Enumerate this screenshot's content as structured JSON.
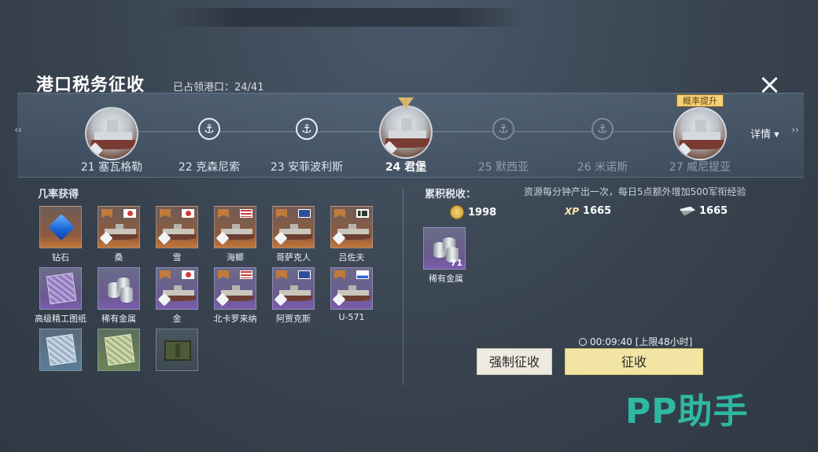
{
  "header": {
    "title": "港口税务征收",
    "occupied_ports": "已占领港口：24/41"
  },
  "ports": [
    {
      "label": "21 塞瓦格勒",
      "type": "ship",
      "state": "normal"
    },
    {
      "label": "22 克森尼索",
      "type": "anchor",
      "state": "normal"
    },
    {
      "label": "23 安菲波利斯",
      "type": "anchor",
      "state": "normal"
    },
    {
      "label": "24 君堡",
      "type": "ship",
      "state": "current"
    },
    {
      "label": "25 默西亚",
      "type": "anchor",
      "state": "dim"
    },
    {
      "label": "26 米诺斯",
      "type": "anchor",
      "state": "dim"
    },
    {
      "label": "27 威尼提亚",
      "type": "ship",
      "state": "dim",
      "badge": "概率提升"
    }
  ],
  "details_label": "详情",
  "left_panel": {
    "title": "几率获得",
    "items": [
      {
        "name": "钻石",
        "rarity": "orange",
        "icon": "diamond-icon"
      },
      {
        "name": "桑",
        "rarity": "orange",
        "icon": "ship-icon",
        "flag": "jp"
      },
      {
        "name": "雪",
        "rarity": "orange",
        "icon": "ship-icon",
        "flag": "jp"
      },
      {
        "name": "海鲫",
        "rarity": "orange",
        "icon": "submarine-icon",
        "flag": "us"
      },
      {
        "name": "哥萨克人",
        "rarity": "orange",
        "icon": "ship-icon",
        "flag": "uk"
      },
      {
        "name": "吕佐夫",
        "rarity": "orange",
        "icon": "ship-icon",
        "flag": "de"
      },
      {
        "name": "高级精工图纸",
        "rarity": "purple",
        "icon": "blueprint-icon"
      },
      {
        "name": "稀有金属",
        "rarity": "purple",
        "icon": "metal-icon"
      },
      {
        "name": "金",
        "rarity": "purple",
        "icon": "ship-icon",
        "flag": "jp"
      },
      {
        "name": "北卡罗来纳",
        "rarity": "purple",
        "icon": "ship-icon",
        "flag": "us"
      },
      {
        "name": "阿贾克斯",
        "rarity": "purple",
        "icon": "ship-icon",
        "flag": "uk"
      },
      {
        "name": "U-571",
        "rarity": "purple",
        "icon": "submarine-icon",
        "flag": "de"
      },
      {
        "name": "",
        "rarity": "blue",
        "icon": "blueprint-icon"
      },
      {
        "name": "",
        "rarity": "green",
        "icon": "blueprint-icon"
      },
      {
        "name": "",
        "rarity": "dark",
        "icon": "crate-icon"
      }
    ]
  },
  "right_panel": {
    "title": "累积税收：",
    "info": "资源每分钟产出一次，每日5点额外增加500军衔经验",
    "resources": [
      {
        "icon": "coin-icon",
        "value": "1998"
      },
      {
        "icon": "xp-icon",
        "value": "1665"
      },
      {
        "icon": "steel-icon",
        "value": "1665"
      }
    ],
    "stock": {
      "name": "稀有金属",
      "count": "71"
    },
    "timer": "00:09:40 [上限48小时]",
    "force_button": "强制征收",
    "collect_button": "征收"
  },
  "watermark": "PP助手",
  "xp_text": "XP"
}
